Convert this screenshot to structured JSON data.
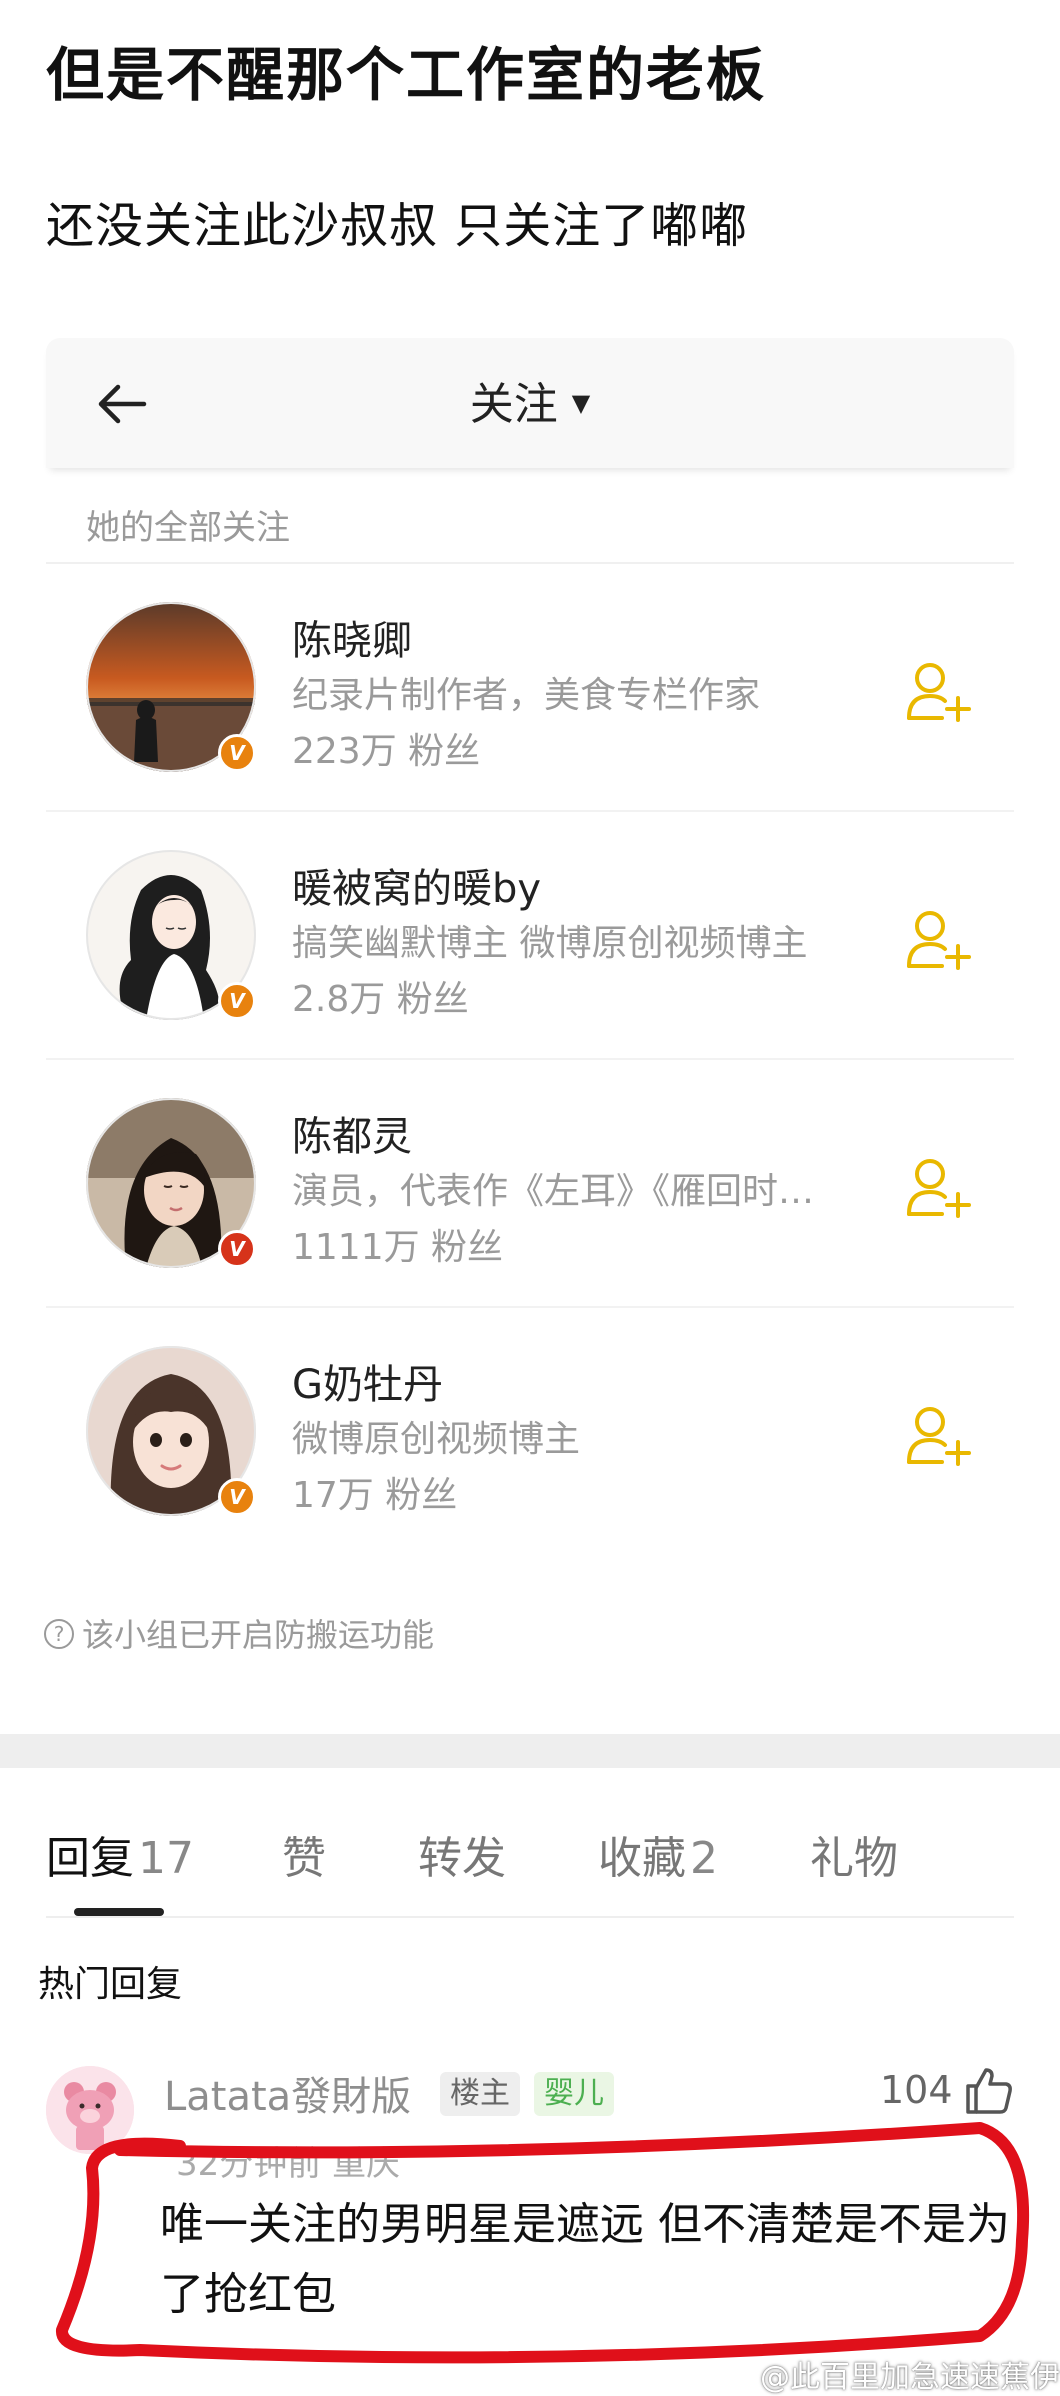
{
  "post": {
    "title": "但是不醒那个工作室的老板",
    "subtitle": "还没关注此沙叔叔  只关注了嘟嘟"
  },
  "nav": {
    "title": "关注"
  },
  "section_label": "她的全部关注",
  "follows": [
    {
      "name": "陈晓卿",
      "desc": "纪录片制作者，美食专栏作家",
      "fans": "223万 粉丝"
    },
    {
      "name": "暖被窝的暖by",
      "desc": "搞笑幽默博主 微博原创视频博主",
      "fans": "2.8万 粉丝"
    },
    {
      "name": "陈都灵",
      "desc": "演员，代表作《左耳》《雁回时…",
      "fans": "1111万 粉丝"
    },
    {
      "name": "G奶牡丹",
      "desc": "微博原创视频博主",
      "fans": "17万 粉丝"
    }
  ],
  "verified_mark": "V",
  "anti_repost": "该小组已开启防搬运功能",
  "tabs": [
    {
      "label": "回复",
      "count": "17"
    },
    {
      "label": "赞",
      "count": ""
    },
    {
      "label": "转发",
      "count": ""
    },
    {
      "label": "收藏",
      "count": "2"
    },
    {
      "label": "礼物",
      "count": ""
    }
  ],
  "hot_title": "热门回复",
  "comment": {
    "user": "Latata發財版",
    "badge_owner": "楼主",
    "badge_level": "婴儿",
    "likes": "104",
    "meta": "32分钟前  重庆",
    "text": "唯一关注的男明星是遮远 但不清楚是不是为了抢红包"
  },
  "watermark": "@此百里加急速速蕉伊",
  "colors": {
    "accent_gold": "#e9b800",
    "verified_orange": "#e8820e",
    "annotation_red": "#e0101a"
  },
  "icons": [
    "back-arrow-icon",
    "caret-down-icon",
    "add-follow-icon",
    "help-icon",
    "thumbs-up-icon"
  ]
}
